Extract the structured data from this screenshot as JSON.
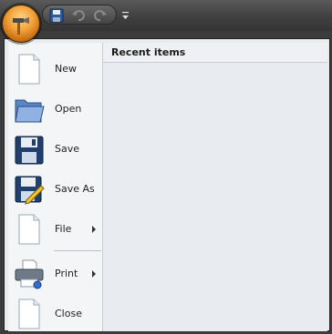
{
  "menu": {
    "recent_header": "Recent items",
    "items": [
      {
        "label": "New",
        "icon": "new-document-icon"
      },
      {
        "label": "Open",
        "icon": "open-folder-icon"
      },
      {
        "label": "Save",
        "icon": "save-disk-icon"
      },
      {
        "label": "Save As",
        "icon": "save-as-icon"
      },
      {
        "label": "File",
        "icon": "file-icon",
        "submenu": true
      },
      {
        "label": "Print",
        "icon": "printer-icon",
        "submenu": true
      },
      {
        "label": "Close",
        "icon": "close-document-icon"
      }
    ]
  },
  "colors": {
    "app_button": "#f3a43a",
    "chrome": "#3c3c3c",
    "menu_bg": "#f3f5f7"
  }
}
